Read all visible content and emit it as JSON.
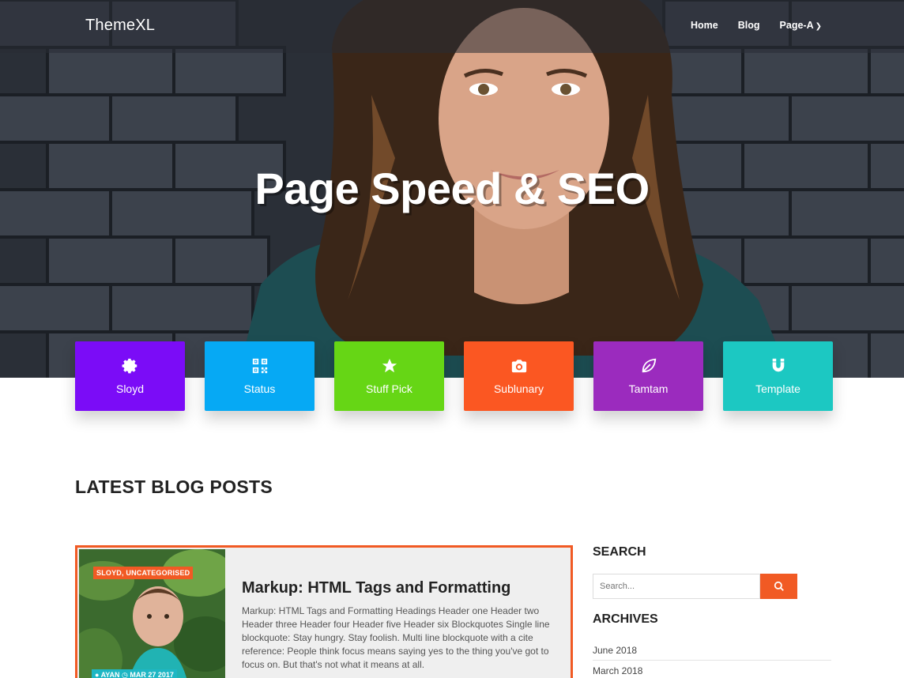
{
  "header": {
    "logo": "ThemeXL",
    "nav": [
      {
        "label": "Home"
      },
      {
        "label": "Blog"
      },
      {
        "label": "Page-A"
      }
    ]
  },
  "hero": {
    "title": "Page Speed & SEO"
  },
  "tiles": [
    {
      "label": "Sloyd",
      "icon": "gear-icon",
      "color": "#7b0cf7"
    },
    {
      "label": "Status",
      "icon": "qr-code-icon",
      "color": "#06a9f4"
    },
    {
      "label": "Stuff Pick",
      "icon": "star-icon",
      "color": "#66d615"
    },
    {
      "label": "Sublunary",
      "icon": "camera-icon",
      "color": "#fb5722"
    },
    {
      "label": "Tamtam",
      "icon": "leaf-icon",
      "color": "#9b2bbe"
    },
    {
      "label": "Template",
      "icon": "magnet-icon",
      "color": "#1cc8c2"
    }
  ],
  "blog": {
    "section_title": "LATEST BLOG POSTS",
    "post": {
      "category": "SLOYD, UNCATEGORISED",
      "author": "AYAN",
      "date": "MAR 27 2017",
      "title": "Markup: HTML Tags and Formatting",
      "excerpt": "Markup: HTML Tags and Formatting Headings Header one Header two Header three Header four Header five Header six Blockquotes Single line blockquote: Stay hungry. Stay foolish. Multi line blockquote with a cite reference: People think focus means saying yes to the thing you've got to focus on. But that's not what it means at all."
    }
  },
  "sidebar": {
    "search_title": "SEARCH",
    "search_placeholder": "Search...",
    "archives_title": "ARCHIVES",
    "archives": [
      "June 2018",
      "March 2018"
    ]
  },
  "colors": {
    "accent": "#f15a24",
    "meta_badge": "#1eb7c4"
  }
}
